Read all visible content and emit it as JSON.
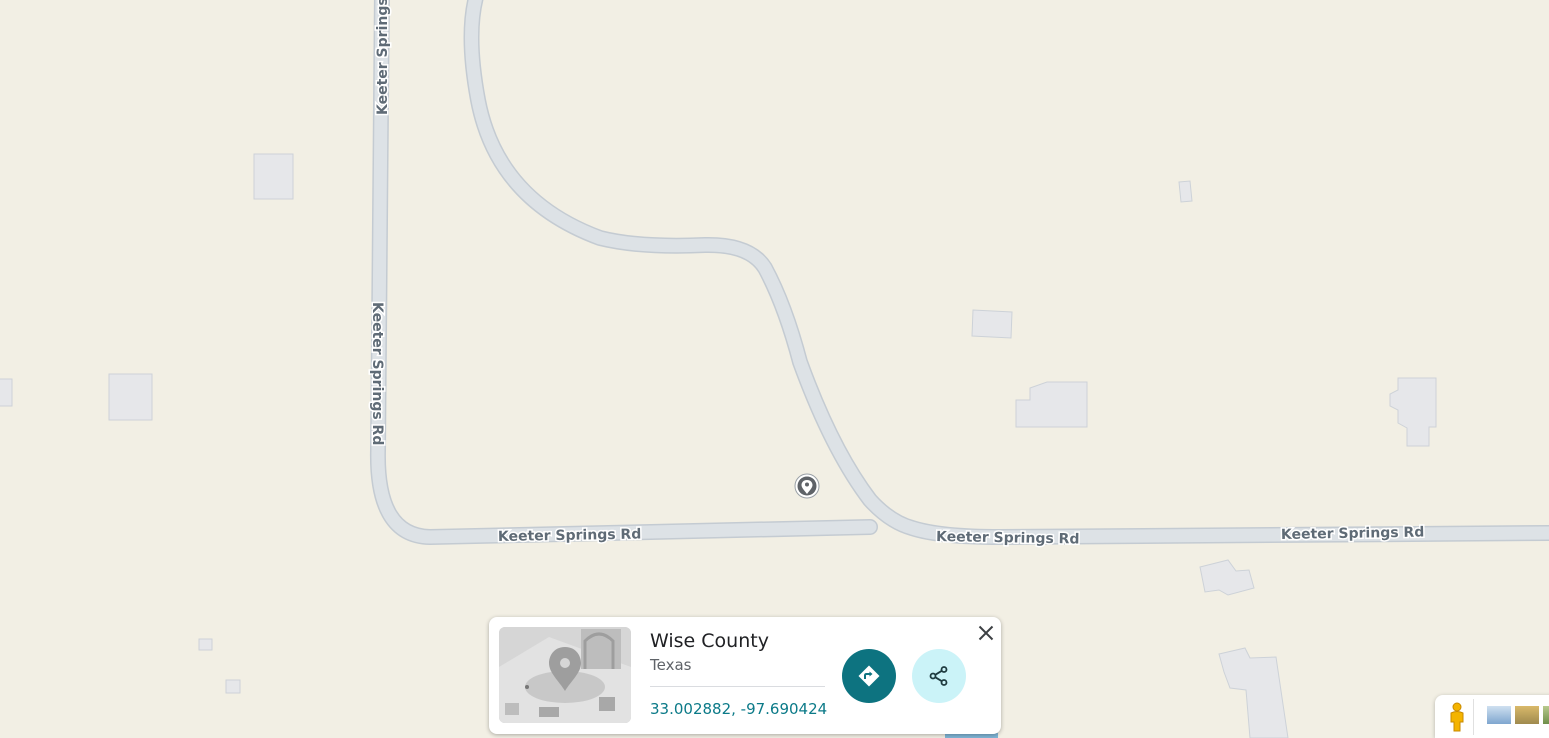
{
  "map": {
    "road_labels": [
      "Keeter Springs Rd",
      "Keeter Springs Rd",
      "Keeter Springs Rd",
      "Keeter Springs Rd",
      "Keeter Springs Rd"
    ],
    "colors": {
      "land": "#f2efe4",
      "road_fill": "#dde2e6",
      "road_casing": "#c4cbd2",
      "building": "#e6e7ea",
      "building_stroke": "#cdd2d8",
      "label_text": "#5f6b76"
    }
  },
  "place_card": {
    "title": "Wise County",
    "subtitle": "Texas",
    "coordinates": "33.002882, -97.690424",
    "directions_icon": "directions-icon",
    "share_icon": "share-icon",
    "close_icon": "close-icon",
    "accent_color": "#0d7380"
  },
  "layers_control": {
    "pegman_icon": "pegman-icon"
  }
}
